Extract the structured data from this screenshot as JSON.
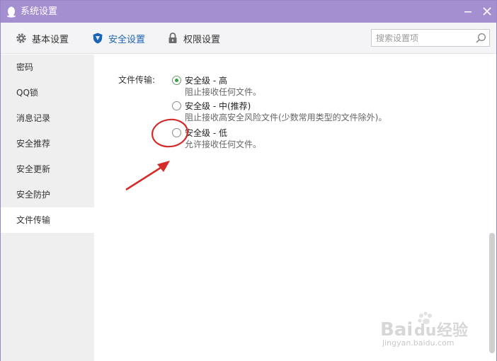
{
  "window": {
    "title": "系统设置",
    "minimize_icon": "minimize-icon",
    "close_icon": "close-icon"
  },
  "tabs": [
    {
      "label": "基本设置",
      "icon": "gear-icon",
      "active": false
    },
    {
      "label": "安全设置",
      "icon": "shield-icon",
      "active": true
    },
    {
      "label": "权限设置",
      "icon": "lock-icon",
      "active": false
    }
  ],
  "search": {
    "placeholder": "搜索设置项",
    "value": "",
    "icon": "search-icon"
  },
  "sidebar": {
    "items": [
      {
        "label": "密码",
        "active": false
      },
      {
        "label": "QQ锁",
        "active": false
      },
      {
        "label": "消息记录",
        "active": false
      },
      {
        "label": "安全推荐",
        "active": false
      },
      {
        "label": "安全更新",
        "active": false
      },
      {
        "label": "安全防护",
        "active": false
      },
      {
        "label": "文件传输",
        "active": true
      }
    ]
  },
  "content": {
    "section_label": "文件传输:",
    "options": [
      {
        "title": "安全级 - 高",
        "description": "阻止接收任何文件。",
        "selected": true
      },
      {
        "title": "安全级 - 中(推荐)",
        "description": "阻止接收高安全风险文件(少数常用类型的文件除外)。",
        "selected": false
      },
      {
        "title": "安全级 - 低",
        "description": "允许接收任何文件。",
        "selected": false
      }
    ]
  },
  "colors": {
    "titlebar": "#a48fd0",
    "active_tab": "#1a64b4",
    "radio_checked": "#3aa142",
    "annotation": "#d42b2b"
  },
  "watermark": {
    "logo_text": "Bai经验",
    "url": "jingyan.baidu.com"
  }
}
